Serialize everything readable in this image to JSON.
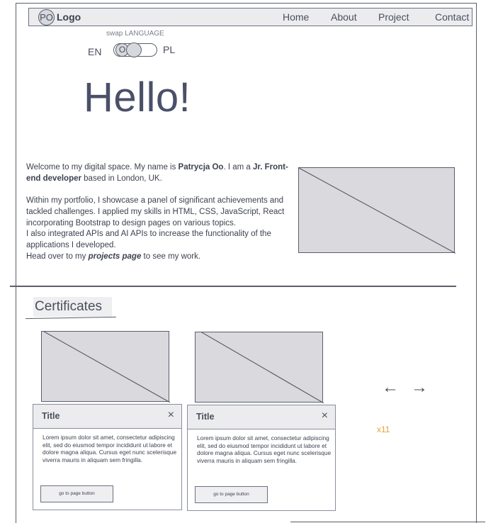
{
  "nav": {
    "logo_initials": "PO",
    "logo_label": "Logo",
    "links": [
      "Home",
      "About",
      "Project",
      "Contact"
    ]
  },
  "language": {
    "swap_label": "swap LANGUAGE",
    "left": "EN",
    "right": "PL",
    "knob_text": "O"
  },
  "hero": {
    "greeting": "Hello!"
  },
  "intro": {
    "p1_before": "Welcome to my digital space. My name is ",
    "name": "Patrycja Oo",
    "p1_mid": ". I am a ",
    "role": "Jr. Front-end developer",
    "p1_after": " based in London, UK.",
    "p2": "Within my portfolio, I showcase a panel of significant achievements and tackled challenges. I applied my skills in HTML, CSS, JavaScript, React incorporating Bootstrap to design pages on various topics.",
    "p3": "I also integrated APIs and AI APIs to increase the functionality of the applications I developed.",
    "p4_before": "Head over to my ",
    "projects_link": "projects page",
    "p4_after": " to see my work."
  },
  "certificates": {
    "heading": "Certificates",
    "cards": [
      {
        "title": "Title",
        "close": "×",
        "body": "Lorem ipsum dolor sit amet, consectetur adipiscing elit, sed do eiusmod tempor incididunt ut labore et dolore magna aliqua. Cursus eget nunc scelerisque viverra mauris in aliquam sem fringilla.",
        "button": "go to page button"
      },
      {
        "title": "Title",
        "close": "×",
        "body": "Lorem ipsum dolor sit amet, consectetur adipiscing elit, sed do eiusmod tempor incididunt ut labore et dolore magna aliqua. Cursus eget nunc scelerisque viverra mauris in aliquam sem fringilla.",
        "button": "go to page button"
      }
    ],
    "prev_arrow": "←",
    "next_arrow": "→",
    "count": "x11"
  },
  "colors": {
    "accent_count": "#e6a23c",
    "placeholder_fill": "#d9d9de",
    "header_fill": "#ececef"
  }
}
